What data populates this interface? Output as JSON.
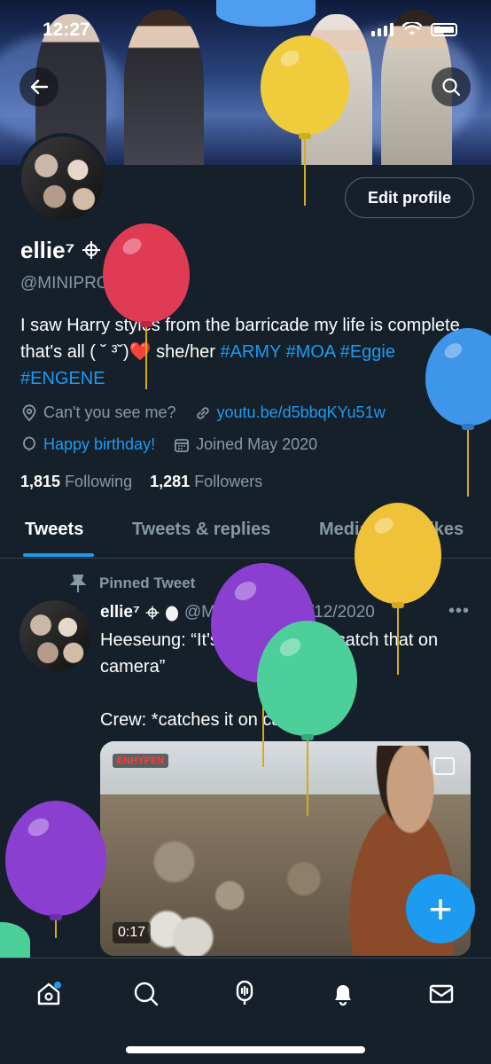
{
  "status_bar": {
    "time": "12:27"
  },
  "profile": {
    "display_name": "ellie⁷",
    "handle": "@MINIPROMISE_",
    "edit_profile_label": "Edit profile",
    "bio_text": "I saw Harry styles from the barricade my life is complete that's all ( ˘ ³˘)❤️ she/her ",
    "bio_hashtags": [
      "#ARMY",
      "#MOA",
      "#Eggie",
      "#ENGENE"
    ],
    "location": "Can't you see me?",
    "website": "youtu.be/d5bbqKYu51w",
    "birthday": "Happy birthday!",
    "joined": "Joined May 2020",
    "following_count": "1,815",
    "following_label": "Following",
    "followers_count": "1,281",
    "followers_label": "Followers"
  },
  "tabs": [
    "Tweets",
    "Tweets & replies",
    "Media",
    "Likes"
  ],
  "pinned_tweet": {
    "pinned_label": "Pinned Tweet",
    "author_name": "ellie⁷",
    "author_handle": "@MINIPR...",
    "date": "02/12/2020",
    "text": "Heeseung: “It's a rare. I didn't catch that on camera”\n\nCrew: *catches it on camera*",
    "video_duration": "0:17",
    "video_logo": "ENHYPEN"
  },
  "icons": {
    "back": "arrow-left-icon",
    "search": "search-icon",
    "location": "location-pin-icon",
    "link": "link-icon",
    "birthday": "balloon-icon",
    "calendar": "calendar-icon",
    "pin": "pin-icon",
    "more": "more-horizontal-icon",
    "compose": "plus-icon"
  },
  "colors": {
    "background": "#15202b",
    "accent": "#1d9bf0",
    "muted": "#8899a6",
    "border": "#38444d"
  }
}
